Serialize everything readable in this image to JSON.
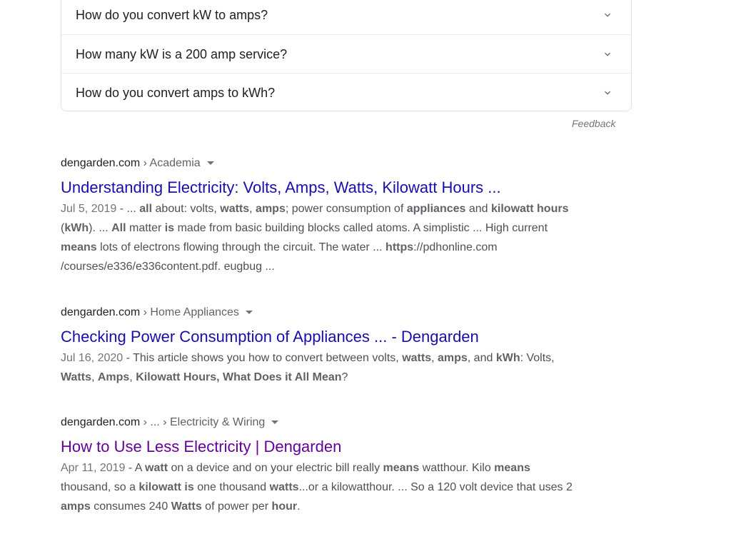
{
  "people_also_ask": {
    "questions": [
      "How do you convert kW to amps?",
      "How many kW is a 200 amp service?",
      "How do you convert amps to kWh?"
    ],
    "feedback": "Feedback"
  },
  "results": [
    {
      "domain": "dengarden.com",
      "path": " › Academia",
      "title": "Understanding Electricity: Volts, Amps, Watts, Kilowatt Hours ...",
      "date": "Jul 5, 2019",
      "snippet": [
        {
          "t": " - ... ",
          "b": false
        },
        {
          "t": "all",
          "b": true
        },
        {
          "t": " about: volts, ",
          "b": false
        },
        {
          "t": "watts",
          "b": true
        },
        {
          "t": ", ",
          "b": false
        },
        {
          "t": "amps",
          "b": true
        },
        {
          "t": "; power consumption of ",
          "b": false
        },
        {
          "t": "appliances",
          "b": true
        },
        {
          "t": " and ",
          "b": false
        },
        {
          "t": "kilowatt hours",
          "b": true
        },
        {
          "t": " (",
          "b": false
        },
        {
          "t": "kWh",
          "b": true
        },
        {
          "t": "). ... ",
          "b": false
        },
        {
          "t": "All",
          "b": true
        },
        {
          "t": " matter ",
          "b": false
        },
        {
          "t": "is",
          "b": true
        },
        {
          "t": " made from basic building blocks called atoms. A simplistic ... High current ",
          "b": false
        },
        {
          "t": "means",
          "b": true
        },
        {
          "t": " lots of electrons flowing through the circuit. The water ... ",
          "b": false
        },
        {
          "t": "https",
          "b": true
        },
        {
          "t": "://pdhonline.com /courses/e336/e336content.pdf. eugbug ...",
          "b": false
        }
      ]
    },
    {
      "domain": "dengarden.com",
      "path": " › Home Appliances",
      "title": "Checking Power Consumption of Appliances ... - Dengarden",
      "date": "Jul 16, 2020",
      "snippet": [
        {
          "t": " - This article shows you how to convert between volts, ",
          "b": false
        },
        {
          "t": "watts",
          "b": true
        },
        {
          "t": ", ",
          "b": false
        },
        {
          "t": "amps",
          "b": true
        },
        {
          "t": ", and ",
          "b": false
        },
        {
          "t": "kWh",
          "b": true
        },
        {
          "t": ": Volts, ",
          "b": false
        },
        {
          "t": "Watts",
          "b": true
        },
        {
          "t": ", ",
          "b": false
        },
        {
          "t": "Amps",
          "b": true
        },
        {
          "t": ", ",
          "b": false
        },
        {
          "t": "Kilowatt Hours, What Does it All Mean",
          "b": true
        },
        {
          "t": "?",
          "b": false
        }
      ]
    },
    {
      "domain": "dengarden.com",
      "path": " › ... › Electricity & Wiring",
      "title": "How to Use Less Electricity | Dengarden",
      "date": "Apr 11, 2019",
      "snippet": [
        {
          "t": " - A ",
          "b": false
        },
        {
          "t": "watt",
          "b": true
        },
        {
          "t": " on a device and on your electric bill really ",
          "b": false
        },
        {
          "t": "means",
          "b": true
        },
        {
          "t": " watthour. Kilo ",
          "b": false
        },
        {
          "t": "means",
          "b": true
        },
        {
          "t": " thousand, so a ",
          "b": false
        },
        {
          "t": "kilowatt is",
          "b": true
        },
        {
          "t": " one thousand ",
          "b": false
        },
        {
          "t": "watts",
          "b": true
        },
        {
          "t": "...or a kilowatthour. ... So a 120 volt device that uses 2 ",
          "b": false
        },
        {
          "t": "amps",
          "b": true
        },
        {
          "t": " consumes 240 ",
          "b": false
        },
        {
          "t": "Watts",
          "b": true
        },
        {
          "t": " of power per ",
          "b": false
        },
        {
          "t": "hour",
          "b": true
        },
        {
          "t": ".",
          "b": false
        }
      ]
    }
  ],
  "colors": {
    "link": "#1a0dab",
    "visited": "#660099",
    "snippet": "#4d5156",
    "date": "#70757a"
  }
}
